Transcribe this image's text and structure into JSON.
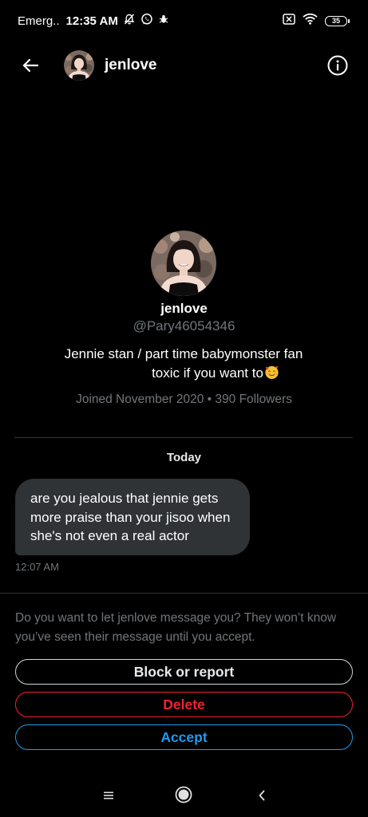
{
  "status_bar": {
    "carrier": "Emerg..",
    "time": "12:35 AM",
    "battery": "35",
    "icons": [
      "mute-bell-icon",
      "whatsapp-icon",
      "bug-icon",
      "sim-x-icon",
      "wifi-icon",
      "battery-icon"
    ]
  },
  "header": {
    "back_icon": "arrow-left-icon",
    "name": "jenlove",
    "info_icon": "info-circle-icon"
  },
  "profile": {
    "name": "jenlove",
    "handle": "@Pary46054346",
    "bio_line1": "Jennie stan / part time babymonster fan",
    "bio_line2": "toxic if you want to",
    "bio_emoji": "smiling-face-with-hearts-icon",
    "joined": "Joined November 2020",
    "separator": "•",
    "followers": "390 Followers"
  },
  "conversation": {
    "date_label": "Today",
    "messages": [
      {
        "text": "are you jealous that jennie gets more praise than your jisoo when she's not even a real actor",
        "time": "12:07 AM"
      }
    ]
  },
  "request": {
    "prompt": "Do you want to let jenlove message you? They won’t know you’ve seen their message until you accept.",
    "block_label": "Block or report",
    "delete_label": "Delete",
    "accept_label": "Accept"
  },
  "nav_bar": {
    "icons": [
      "menu-icon",
      "home-circle-icon",
      "back-chevron-icon"
    ]
  },
  "colors": {
    "background": "#000000",
    "bubble": "#2f3336",
    "muted_text": "#71767b",
    "delete_red": "#f4212e",
    "accept_blue": "#1d9bf0"
  }
}
